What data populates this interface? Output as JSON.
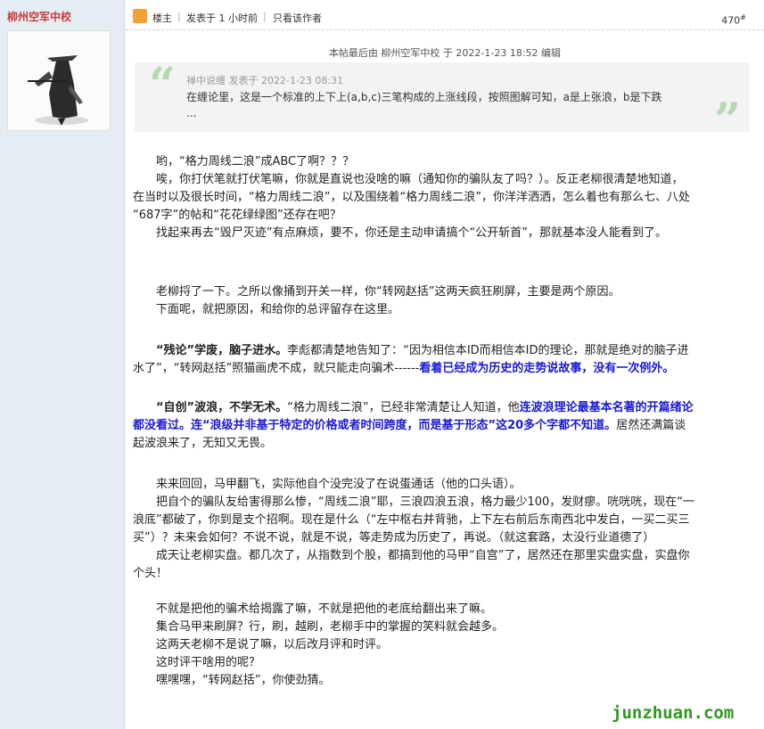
{
  "sidebar": {
    "author_name": "柳州空军中校"
  },
  "header": {
    "role": "楼主",
    "sep": "|",
    "posted": "发表于 1 小时前",
    "only_author": "只看该作者",
    "floor_num": "470",
    "floor_mark": "#"
  },
  "edit_note": "本帖最后由 柳州空军中校 于 2022-1-23 18:52 编辑",
  "quote": {
    "open_mark": "“",
    "close_mark": "”",
    "author_line": "禅中说缠 发表于 2022-1-23 08:31",
    "line1": "在缠论里，这是一个标准的上下上(a,b,c)三笔构成的上涨线段，按照图解可知，a是上张浪，b是下跌",
    "line2": "..."
  },
  "body": {
    "l1": "　　哟，“格力周线二浪”成ABC了啊？？？",
    "l2": "　　唉，你打伏笔就打伏笔嘛，你就是直说也没啥的嘛（通知你的骗队友了吗？）。反正老柳很清楚地知道，",
    "l3": "在当时以及很长时间，“格力周线二浪”，以及围绕着“格力周线二浪”，你洋洋洒洒，怎么着也有那么七、八处",
    "l4": "“687字”的帖和“花花绿绿图”还存在吧？",
    "l5": "　　找起来再去“毁尸灭迹”有点麻烦，要不，你还是主动申请搞个“公开斩首”，那就基本没人能看到了。",
    "l6": "　　老柳捋了一下。之所以像捅到开关一样，你“转网赵括”这两天疯狂刷屏，主要是两个原因。",
    "l7": "　　下面呢，就把原因，和给你的总评留存在这里。",
    "p1_bold": "　　“残论”学废，脑子进水。",
    "p1_text": "李彪都清楚地告知了：“因为相信本ID而相信本ID的理论，那就是绝对的脑子进",
    "p1_l2": "水了”，“转网赵括”照猫画虎不成，就只能走向骗术------",
    "p1_blue": "看着已经成为历史的走势说故事，没有一次例外。",
    "p2_bold": "　　“自创”波浪，不学无术。",
    "p2_text": "“格力周线二浪”，已经非常清楚让人知道，他",
    "p2_blue1": "连波浪理论最基本名著的开篇绪论",
    "p2_blue2": "都没看过。连“浪级并非基于特定的价格或者时间跨度，而是基于形态”这20多个字都不知道。",
    "p2_tail": "居然还满篇谈",
    "p2_l3": "起波浪来了，无知又无畏。",
    "l8": "　　来来回回，马甲翻飞，实际他自个没完没了在说蛋通话（他的口头语）。",
    "l9": "　　把自个的骗队友给害得那么惨，“周线二浪”耶，三浪四浪五浪，格力最少100，发财瘳。咣咣咣，现在“一",
    "l10": "浪底”都破了，你到是支个招啊。现在是什么（“左中枢右并背驰，上下左右前后东南西北中发白，一买二买三",
    "l11": "买”）？未来会如何？不说不说，就是不说，等走势成为历史了，再说。（就这套路，太没行业道德了）",
    "l12": "　　成天让老柳实盘。都几次了，从指数到个股，都搞到他的马甲“自宫”了，居然还在那里实盘实盘，实盘你",
    "l13": "个头！",
    "l14": "　　不就是把他的骗术给揭露了嘛，不就是把他的老底给翻出来了嘛。",
    "l15": "　　集合马甲来刷屏？行，刷，越刷，老柳手中的掌握的笑料就会越多。",
    "l16": "　　这两天老柳不是说了嘛，以后改月评和时评。",
    "l17": "　　这时评干啥用的呢？",
    "l18": "　　嘿嘿嘿，“转网赵括”，你使劲猜。"
  },
  "watermark": "junzhuan.com",
  "icons": {
    "author_icon": "user-badge-icon",
    "avatar": "swordsman-avatar"
  }
}
